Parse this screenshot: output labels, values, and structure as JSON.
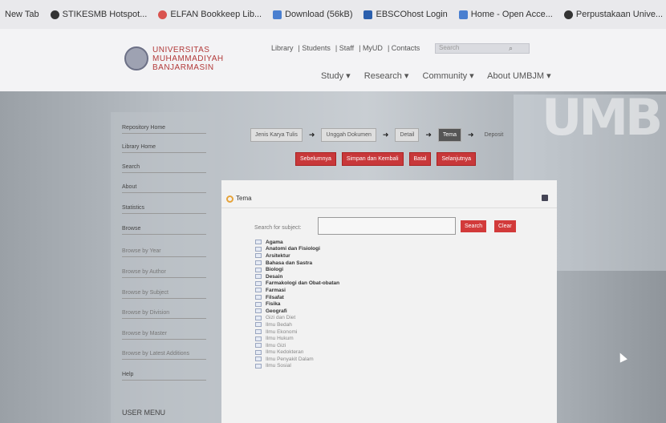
{
  "bookmarks": [
    {
      "label": "New Tab",
      "icon": "none"
    },
    {
      "label": "STIKESMB Hotspot...",
      "icon": "globe-icon",
      "color": "#333333"
    },
    {
      "label": "ELFAN Bookkeep Lib...",
      "icon": "bookmark-icon",
      "color": "#d9534f"
    },
    {
      "label": "Download (56kB)",
      "icon": "file-icon",
      "color": "#4a7fd0"
    },
    {
      "label": "EBSCOhost Login",
      "icon": "ebsco-icon",
      "color": "#2b5fad"
    },
    {
      "label": "Home - Open Acce...",
      "icon": "file-icon",
      "color": "#4a7fd0"
    },
    {
      "label": "Perpustakaan Unive...",
      "icon": "globe-icon",
      "color": "#333333"
    }
  ],
  "header": {
    "logo_line1": "UNIVERSITAS",
    "logo_line2": "MUHAMMADIYAH",
    "logo_line3": "BANJARMASIN",
    "toplinks": [
      "Library",
      "Students",
      "Staff",
      "MyUD",
      "Contacts"
    ],
    "search_placeholder": "Search",
    "nav": [
      "Study ▾",
      "Research ▾",
      "Community ▾",
      "About UMBJM ▾"
    ]
  },
  "sidebar": {
    "items": [
      "Repository Home",
      "Library Home",
      "Search",
      "About",
      "Statistics",
      "Browse"
    ],
    "browse_sub": [
      "Browse by Year",
      "Browse by Author",
      "Browse by Subject",
      "Browse by Division",
      "Browse by Master",
      "Browse by Latest Additions"
    ],
    "extra": "Help",
    "user_menu": "USER MENU"
  },
  "steps": {
    "items": [
      "Jenis Karya Tulis",
      "Unggah Dokumen",
      "Detail",
      "Tema",
      "Deposit"
    ],
    "active": "Tema"
  },
  "actions": [
    "Sebelumnya",
    "Simpan dan Kembali",
    "Batal",
    "Selanjutnya"
  ],
  "panel": {
    "title": "Tema",
    "search_label": "Search for subject:",
    "search_button": "Search",
    "clear_button": "Clear"
  },
  "subjects": [
    "Agama",
    "Anatomi dan Fisiologi",
    "Arsitektur",
    "Bahasa dan Sastra",
    "Biologi",
    "Desain",
    "Farmakologi dan Obat-obatan",
    "Farmasi",
    "Filsafat",
    "Fisika",
    "Geografi",
    "Gizi dan Diet",
    "Ilmu Bedah",
    "Ilmu Ekonomi",
    "Ilmu Hukum",
    "Ilmu Gizi",
    "Ilmu Kedokteran",
    "Ilmu Penyakit Dalam",
    "Ilmu Sosial"
  ],
  "colors": {
    "accent": "#c8383a",
    "logo_text": "#b23a3a"
  }
}
